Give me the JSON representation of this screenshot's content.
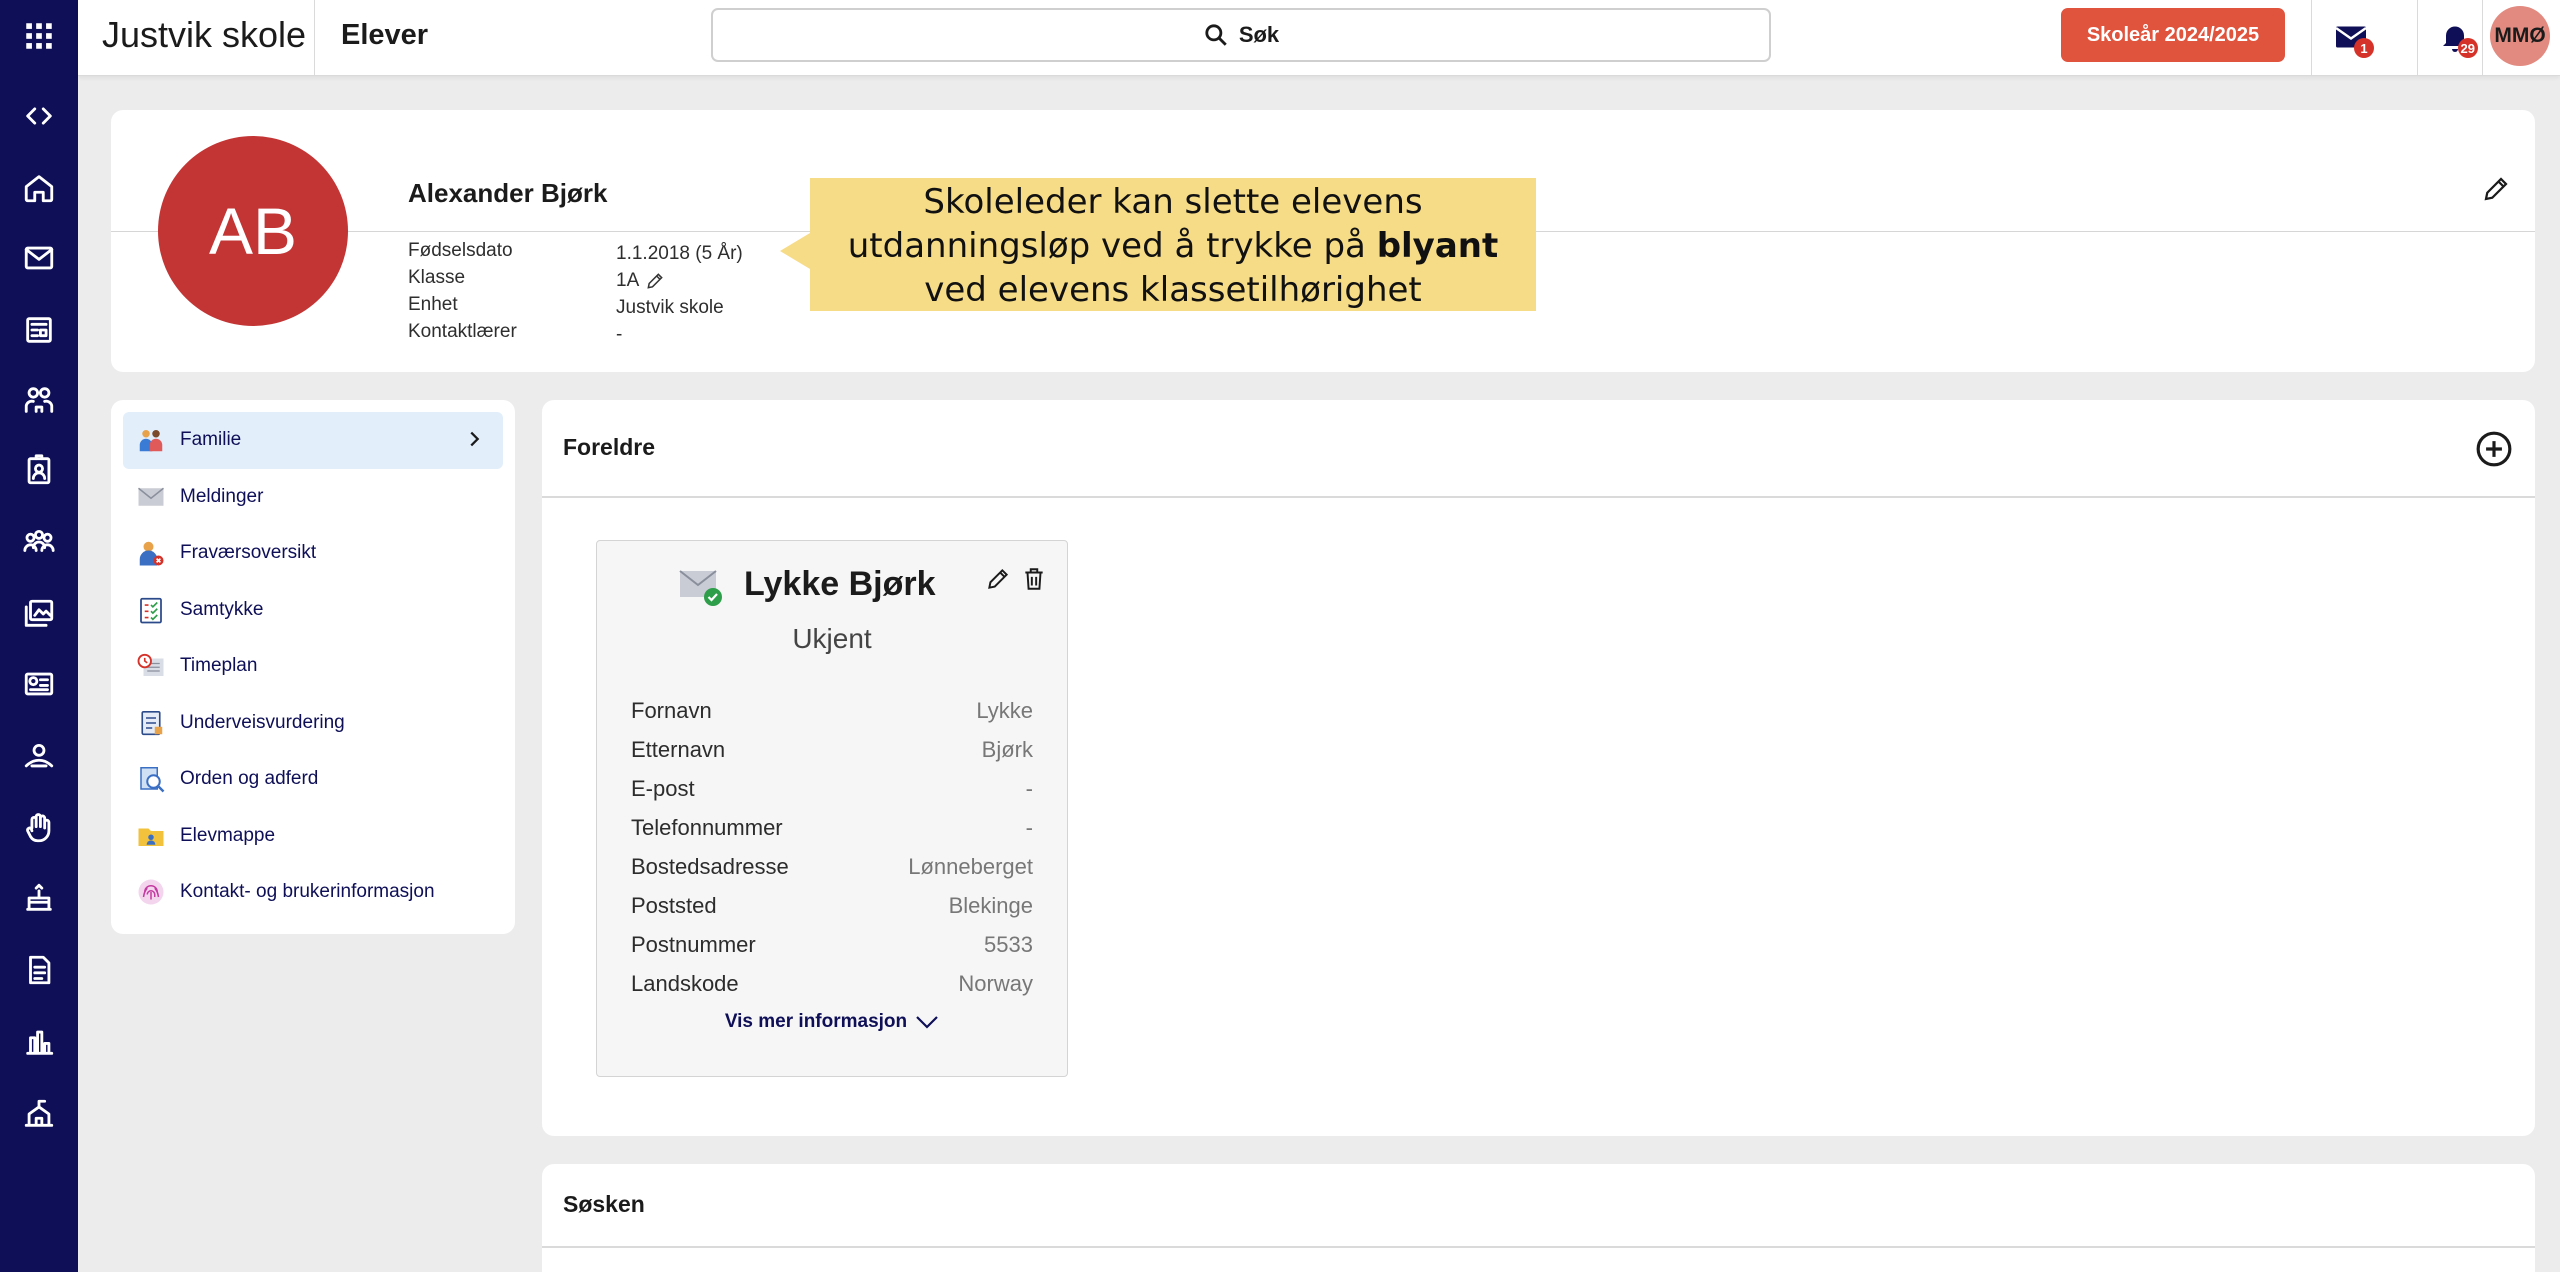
{
  "header": {
    "school_name": "Justvik skole",
    "section_title": "Elever",
    "search_label": "Søk",
    "school_year_button": "Skoleår 2024/2025",
    "messages_badge": "1",
    "notifications_badge": "29",
    "user_initials": "MMØ"
  },
  "student": {
    "initials": "AB",
    "name": "Alexander Bjørk",
    "fields": [
      {
        "label": "Fødselsdato",
        "value": "1.1.2018 (5 År)"
      },
      {
        "label": "Klasse",
        "value": "1A"
      },
      {
        "label": "Enhet",
        "value": "Justvik skole"
      },
      {
        "label": "Kontaktlærer",
        "value": "-"
      }
    ]
  },
  "callout": {
    "line1": "Skoleleder kan slette elevens",
    "line2_pre": "utdanningsløp ved å trykke på ",
    "line2_bold": "blyant",
    "line3": "ved elevens klassetilhørighet"
  },
  "menu": {
    "items": [
      {
        "label": "Familie",
        "icon": "family-icon"
      },
      {
        "label": "Meldinger",
        "icon": "envelope-icon"
      },
      {
        "label": "Fraværsoversikt",
        "icon": "absence-icon"
      },
      {
        "label": "Samtykke",
        "icon": "clipboard-icon"
      },
      {
        "label": "Timeplan",
        "icon": "timetable-icon"
      },
      {
        "label": "Underveisvurdering",
        "icon": "assessment-icon"
      },
      {
        "label": "Orden og adferd",
        "icon": "conduct-icon"
      },
      {
        "label": "Elevmappe",
        "icon": "folder-icon"
      },
      {
        "label": "Kontakt- og brukerinformasjon",
        "icon": "fingerprint-icon"
      }
    ]
  },
  "parents": {
    "title": "Foreldre",
    "card": {
      "name": "Lykke Bjørk",
      "role": "Ukjent",
      "rows": [
        {
          "label": "Fornavn",
          "value": "Lykke"
        },
        {
          "label": "Etternavn",
          "value": "Bjørk"
        },
        {
          "label": "E-post",
          "value": "-"
        },
        {
          "label": "Telefonnummer",
          "value": "-"
        },
        {
          "label": "Bostedsadresse",
          "value": "Lønneberget"
        },
        {
          "label": "Poststed",
          "value": "Blekinge"
        },
        {
          "label": "Postnummer",
          "value": "5533"
        },
        {
          "label": "Landskode",
          "value": "Norway"
        }
      ],
      "more_label": "Vis mer informasjon"
    }
  },
  "siblings": {
    "title": "Søsken"
  },
  "colors": {
    "rail": "#0e0f57",
    "accent_button": "#e0533d",
    "avatar": "#c33535",
    "callout": "#f7dc87",
    "menu_active": "#e3eefb"
  }
}
